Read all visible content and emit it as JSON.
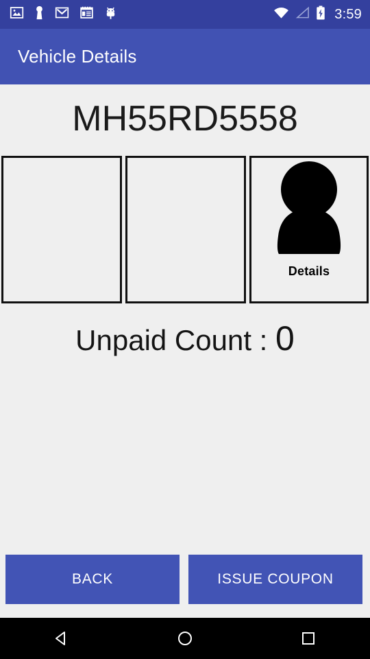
{
  "status_bar": {
    "time": "3:59",
    "background_color": "#34409E",
    "left_icons": [
      {
        "name": "photos-icon",
        "label": "Photos"
      },
      {
        "name": "keyhole-person-icon",
        "label": "Contacts"
      },
      {
        "name": "gmail-icon",
        "label": "Gmail"
      },
      {
        "name": "calendar-icon",
        "label": "Calendar"
      },
      {
        "name": "android-bug-icon",
        "label": "Android"
      }
    ],
    "right_icons": [
      {
        "name": "wifi-icon",
        "label": "Wi-Fi"
      },
      {
        "name": "signal-icon",
        "label": "Signal"
      },
      {
        "name": "battery-charging-icon",
        "label": "Battery charging"
      }
    ]
  },
  "app_bar": {
    "title": "Vehicle Details",
    "background_color": "#4152B3",
    "text_color": "#FFFFFF"
  },
  "main": {
    "vehicle_number": "MH55RD5558",
    "tiles": [
      {
        "name": "tile-empty-1",
        "label": "",
        "icon": ""
      },
      {
        "name": "tile-empty-2",
        "label": "",
        "icon": ""
      },
      {
        "name": "tile-details",
        "label": "Details",
        "icon": "person-icon"
      }
    ],
    "unpaid": {
      "label": "Unpaid Count : ",
      "value": "0"
    },
    "background_color": "#EFEFEF"
  },
  "buttons": {
    "back_label": "BACK",
    "issue_coupon_label": "ISSUE COUPON",
    "background_color": "#4254B5",
    "text_color": "#FFFFFF"
  },
  "nav_bar": {
    "background_color": "#000000",
    "items": [
      {
        "name": "nav-back-icon",
        "label": "Back"
      },
      {
        "name": "nav-home-icon",
        "label": "Home"
      },
      {
        "name": "nav-recents-icon",
        "label": "Recents"
      }
    ]
  }
}
